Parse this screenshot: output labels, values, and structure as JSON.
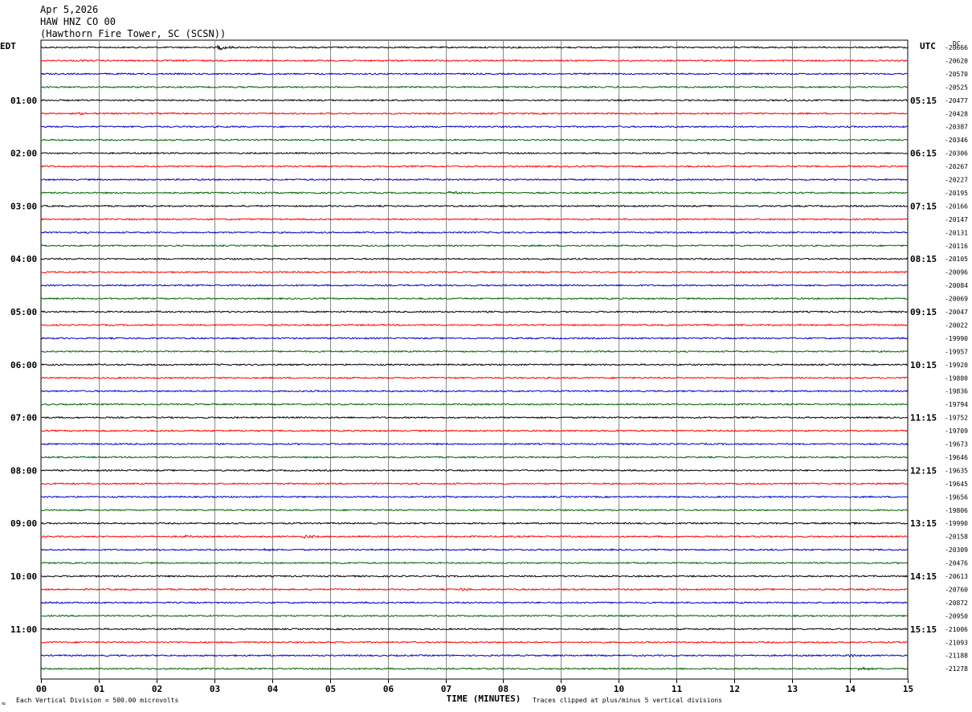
{
  "header": {
    "date": "Apr 5,2026",
    "station": "HAW HNZ CO 00",
    "location": "(Hawthorn Fire Tower, SC (SCSN))"
  },
  "left_axis_title": "EDT",
  "right_axis_title": "UTC",
  "dc_header": "DC",
  "footer": {
    "vertical_division": "Each Vertical Division =  500.00 microvolts",
    "clipping_note": "Traces clipped at plus/minus 5 vertical divisions",
    "corner_mark": "≈"
  },
  "chart_data": {
    "type": "line",
    "title": "",
    "xlabel": "TIME (MINUTES)",
    "ylabel": "",
    "xlim": [
      0,
      15
    ],
    "x_ticks": [
      "00",
      "01",
      "02",
      "03",
      "04",
      "05",
      "06",
      "07",
      "08",
      "09",
      "10",
      "11",
      "12",
      "13",
      "14",
      "15"
    ],
    "lines_per_hour": 4,
    "minutes_per_line": 15,
    "trace_colors": [
      "#000000",
      "#ff0000",
      "#0000c8",
      "#006400"
    ],
    "grid": true,
    "left_hour_labels": [
      "01:00",
      "02:00",
      "03:00",
      "04:00",
      "05:00",
      "06:00",
      "07:00",
      "08:00",
      "09:00",
      "10:00",
      "11:00"
    ],
    "right_hour_labels": [
      "05:15",
      "06:15",
      "07:15",
      "08:15",
      "09:15",
      "10:15",
      "11:15",
      "12:15",
      "13:15",
      "14:15",
      "15:15"
    ],
    "dc_offsets": [
      -20666,
      -20620,
      -20570,
      -20525,
      -20477,
      -20428,
      -20387,
      -20346,
      -20306,
      -20267,
      -20227,
      -20195,
      -20166,
      -20147,
      -20131,
      -20116,
      -20105,
      -20096,
      -20084,
      -20069,
      -20047,
      -20022,
      -19990,
      -19957,
      -19920,
      -19880,
      -19836,
      -19794,
      -19752,
      -19709,
      -19673,
      -19646,
      -19635,
      -19645,
      -19656,
      -19806,
      -19990,
      -20158,
      -20309,
      -20476,
      -20613,
      -20760,
      -20872,
      -20950,
      -21006,
      -21093,
      -21188,
      -21278
    ],
    "trace_activity": [
      [
        {
          "start": 3.1,
          "amp": 3.0
        }
      ],
      [
        {
          "start": 0.7,
          "amp": 1.5
        }
      ],
      [],
      [
        {
          "start": 10.0,
          "amp": 1.2
        }
      ],
      [
        {
          "start": 12.9,
          "amp": 1.5
        }
      ],
      [
        {
          "start": 0.7,
          "amp": 1.5
        }
      ],
      [],
      [
        {
          "start": 11.2,
          "amp": 1.3
        }
      ],
      [],
      [],
      [],
      [
        {
          "start": 7.1,
          "amp": 2.2
        }
      ],
      [],
      [],
      [],
      [],
      [],
      [],
      [],
      [],
      [],
      [],
      [],
      [],
      [],
      [],
      [],
      [],
      [],
      [],
      [],
      [],
      [],
      [],
      [],
      [],
      [
        {
          "start": 14.0,
          "amp": 1.8
        }
      ],
      [
        {
          "start": 2.5,
          "amp": 1.6
        },
        {
          "start": 4.6,
          "amp": 2.2
        }
      ],
      [
        {
          "start": 2.1,
          "amp": 1.4
        },
        {
          "start": 3.9,
          "amp": 1.6
        }
      ],
      [
        {
          "start": 5.2,
          "amp": 1.5
        },
        {
          "start": 10.1,
          "amp": 1.3
        }
      ],
      [
        {
          "start": 1.0,
          "amp": 1.2
        }
      ],
      [
        {
          "start": 7.3,
          "amp": 2.0
        }
      ],
      [],
      [],
      [],
      [],
      [
        {
          "start": 14.0,
          "amp": 2.2
        }
      ],
      [
        {
          "start": 14.2,
          "amp": 2.4
        },
        {
          "start": 3.0,
          "amp": 1.4
        }
      ]
    ]
  }
}
